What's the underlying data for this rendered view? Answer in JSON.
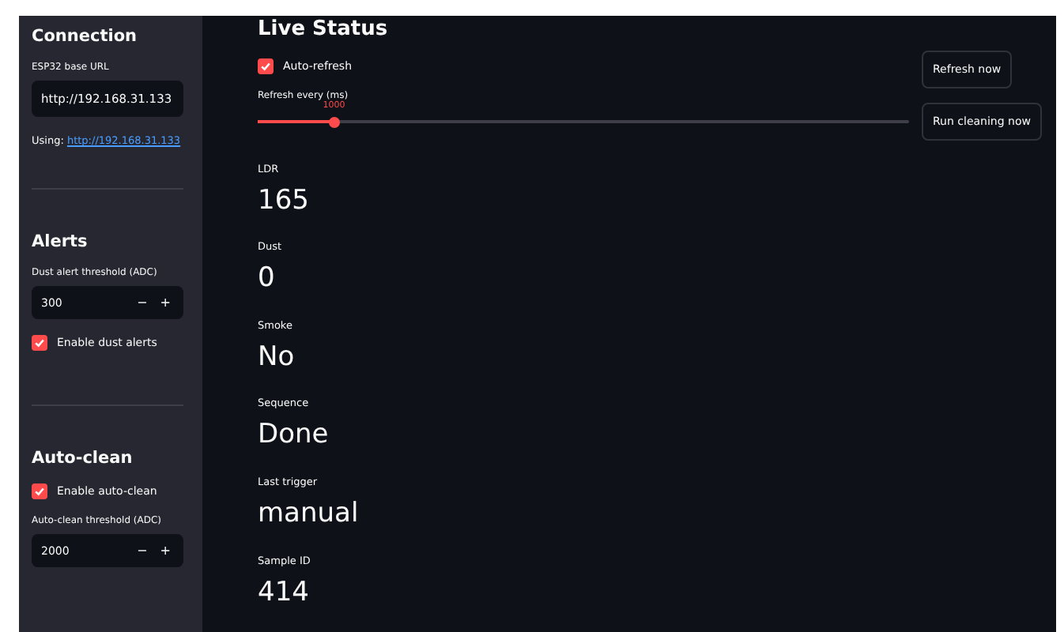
{
  "sidebar": {
    "sections": [
      {
        "title": "Connection",
        "controls": [
          {
            "kind": "text",
            "label": "ESP32 base URL",
            "value": "http://192.168.31.133"
          },
          {
            "kind": "link",
            "prefix": "Using:",
            "link": "http://192.168.31.133"
          }
        ]
      },
      {
        "title": "Alerts",
        "controls": [
          {
            "kind": "number",
            "label": "Dust alert threshold (ADC)",
            "value": "300",
            "minus": "−",
            "plus": "+"
          },
          {
            "kind": "checkbox",
            "label": "Enable dust alerts",
            "checked": true
          }
        ]
      },
      {
        "title": "Auto-clean",
        "controls": [
          {
            "kind": "checkbox",
            "label": "Enable auto-clean",
            "checked": true
          },
          {
            "kind": "number",
            "label": "Auto-clean threshold (ADC)",
            "value": "2000",
            "minus": "−",
            "plus": "+"
          }
        ]
      }
    ]
  },
  "main": {
    "title": "Live Status",
    "auto_refresh": {
      "label": "Auto-refresh",
      "checked": true
    },
    "slider": {
      "label": "Refresh every (ms)",
      "value": "1000",
      "level": 0.117
    },
    "buttons": [
      "Refresh now",
      "Run cleaning now"
    ],
    "metrics": [
      {
        "label": "LDR",
        "value": "165"
      },
      {
        "label": "Dust",
        "value": "0"
      },
      {
        "label": "Smoke",
        "value": "No"
      },
      {
        "label": "Sequence",
        "value": "Done"
      },
      {
        "label": "Last trigger",
        "value": "manual"
      },
      {
        "label": "Sample ID",
        "value": "414"
      }
    ]
  }
}
